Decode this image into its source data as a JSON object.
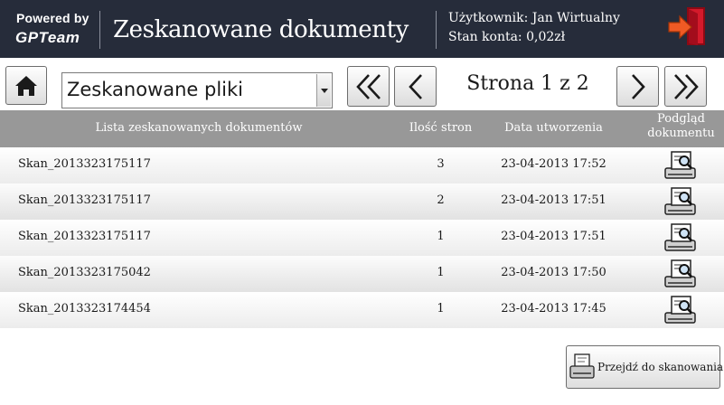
{
  "header": {
    "powered_by": "Powered by",
    "brand": "GPTeam",
    "title": "Zeskanowane dokumenty",
    "user_line": "Użytkownik: Jan Wirtualny",
    "balance_line": "Stan konta: 0,02zł",
    "logout_icon": "exit-door-icon"
  },
  "toolbar": {
    "home_icon": "home-icon",
    "select_value": "Zeskanowane pliki",
    "page_label": "Strona 1 z 2",
    "first_icon": "double-chevron-left-icon",
    "prev_icon": "chevron-left-icon",
    "next_icon": "chevron-right-icon",
    "last_icon": "double-chevron-right-icon"
  },
  "table": {
    "headers": {
      "name": "Lista zeskanowanych dokumentów",
      "pages": "Ilość stron",
      "date": "Data utworzenia",
      "preview": "Podgląd dokumentu"
    },
    "rows": [
      {
        "name": "Skan_2013323175117",
        "pages": "3",
        "date": "23-04-2013 17:52"
      },
      {
        "name": "Skan_2013323175117",
        "pages": "2",
        "date": "23-04-2013 17:51"
      },
      {
        "name": "Skan_2013323175117",
        "pages": "1",
        "date": "23-04-2013 17:51"
      },
      {
        "name": "Skan_2013323175042",
        "pages": "1",
        "date": "23-04-2013 17:50"
      },
      {
        "name": "Skan_2013323174454",
        "pages": "1",
        "date": "23-04-2013 17:45"
      }
    ],
    "preview_icon": "document-preview-icon"
  },
  "footer": {
    "scan_label": "Przejdź do skanowania",
    "scan_icon": "scanner-icon"
  },
  "colors": {
    "header_bg": "#262c3a",
    "table_header_bg": "#989898",
    "logout_door": "#c8102e",
    "logout_arrow": "#e8541c"
  }
}
